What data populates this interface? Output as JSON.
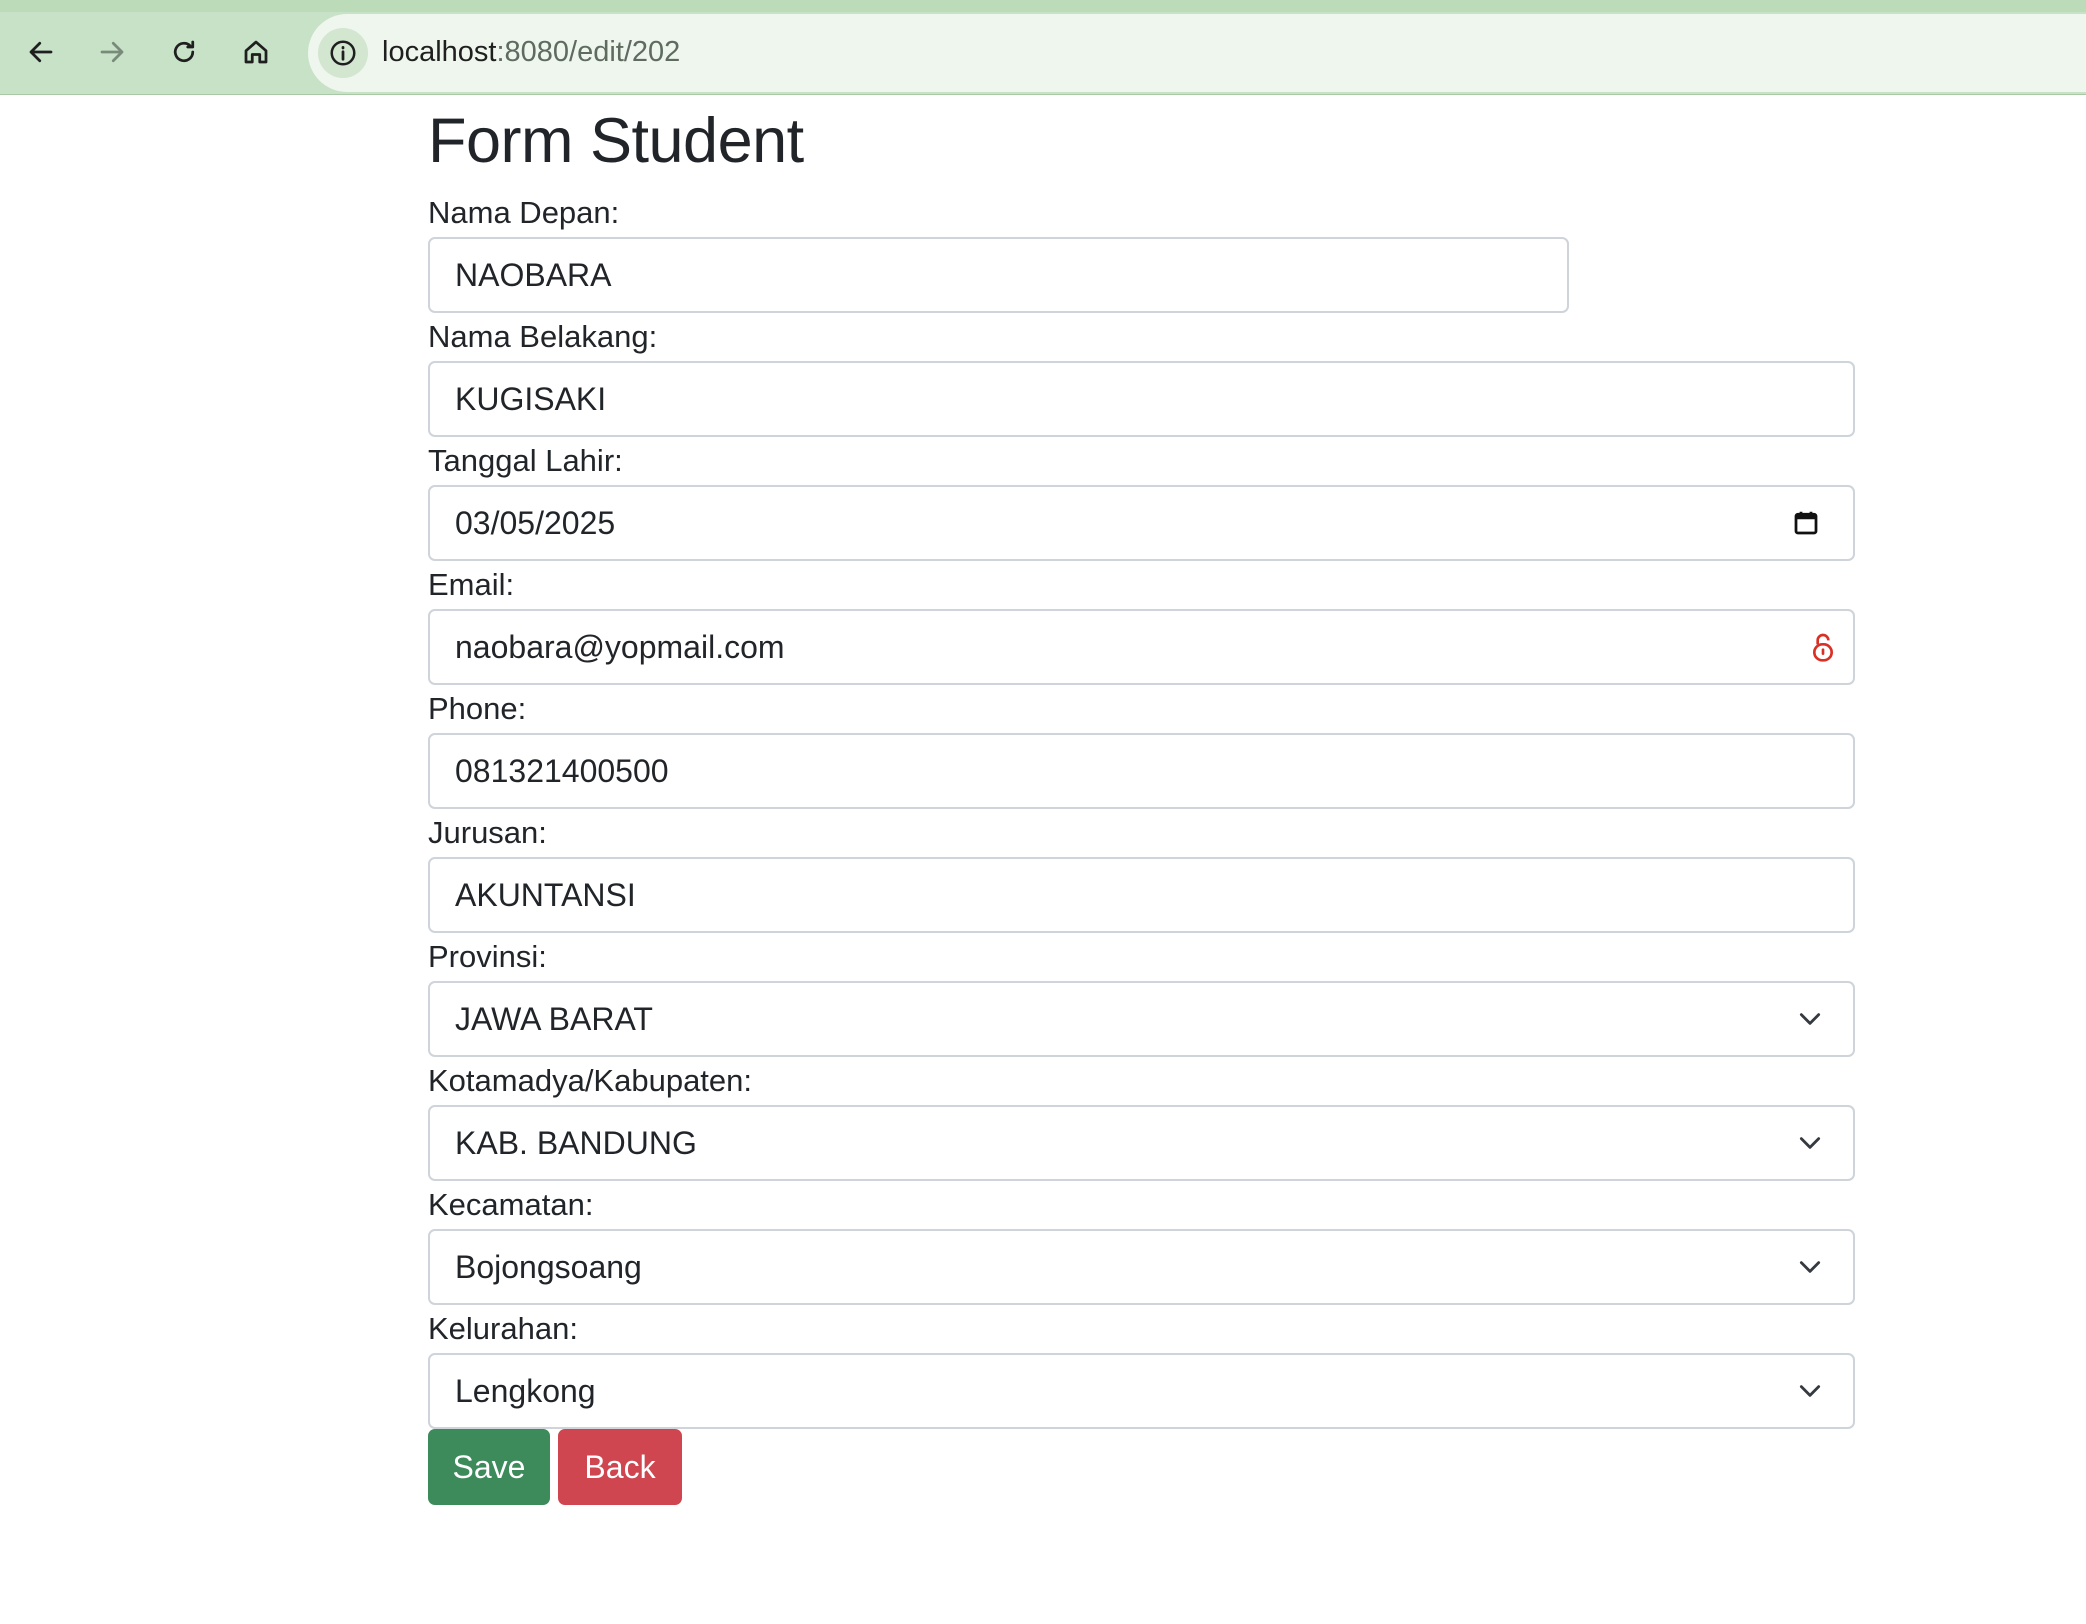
{
  "browser": {
    "url_host": "localhost",
    "url_rest": ":8080/edit/202"
  },
  "form": {
    "title": "Form Student",
    "fields": [
      {
        "label": "Nama Depan:",
        "value": "NAOBARA"
      },
      {
        "label": "Nama Belakang:",
        "value": "KUGISAKI"
      },
      {
        "label": "Tanggal Lahir:",
        "value": "03/05/2025"
      },
      {
        "label": "Email:",
        "value": "naobara@yopmail.com"
      },
      {
        "label": "Phone:",
        "value": "081321400500"
      },
      {
        "label": "Jurusan:",
        "value": "AKUNTANSI"
      },
      {
        "label": "Provinsi:",
        "value": "JAWA BARAT"
      },
      {
        "label": "Kotamadya/Kabupaten:",
        "value": "KAB. BANDUNG"
      },
      {
        "label": "Kecamatan:",
        "value": "Bojongsoang"
      },
      {
        "label": "Kelurahan:",
        "value": "Lengkong"
      }
    ],
    "save_label": "Save",
    "back_label": "Back"
  },
  "colors": {
    "save": "#3d8a5a",
    "back": "#cf4650",
    "toolbar": "#c8e2c7",
    "password_manager_icon": "#d93025"
  },
  "icons": [
    "back-arrow-icon",
    "forward-arrow-icon",
    "reload-icon",
    "home-icon",
    "site-info-icon",
    "calendar-icon",
    "password-lock-icon",
    "chevron-down-icon"
  ]
}
